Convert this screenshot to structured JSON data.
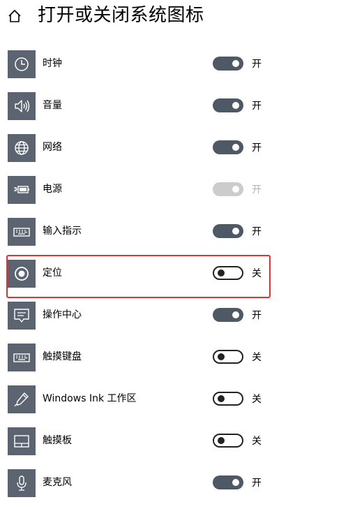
{
  "header": {
    "title": "打开或关闭系统图标"
  },
  "highlight_color": "#e5322c",
  "toggle_on_color": "#4f5966",
  "icon_tile_color": "#5b6470",
  "items": [
    {
      "label": "时钟",
      "icon": "clock-icon",
      "state": "on",
      "state_label": "开"
    },
    {
      "label": "音量",
      "icon": "volume-icon",
      "state": "on",
      "state_label": "开"
    },
    {
      "label": "网络",
      "icon": "globe-icon",
      "state": "on",
      "state_label": "开"
    },
    {
      "label": "电源",
      "icon": "battery-plug-icon",
      "state": "disabled",
      "state_label": "开"
    },
    {
      "label": "输入指示",
      "icon": "keyboard-icon",
      "state": "on",
      "state_label": "开"
    },
    {
      "label": "定位",
      "icon": "location-icon",
      "state": "off",
      "state_label": "关",
      "highlighted": true
    },
    {
      "label": "操作中心",
      "icon": "action-center-icon",
      "state": "on",
      "state_label": "开"
    },
    {
      "label": "触摸键盘",
      "icon": "touch-keyboard-icon",
      "state": "off",
      "state_label": "关"
    },
    {
      "label": "Windows Ink 工作区",
      "icon": "pen-icon",
      "state": "off",
      "state_label": "关"
    },
    {
      "label": "触摸板",
      "icon": "touchpad-icon",
      "state": "off",
      "state_label": "关"
    },
    {
      "label": "麦克风",
      "icon": "microphone-icon",
      "state": "on",
      "state_label": "开"
    }
  ]
}
